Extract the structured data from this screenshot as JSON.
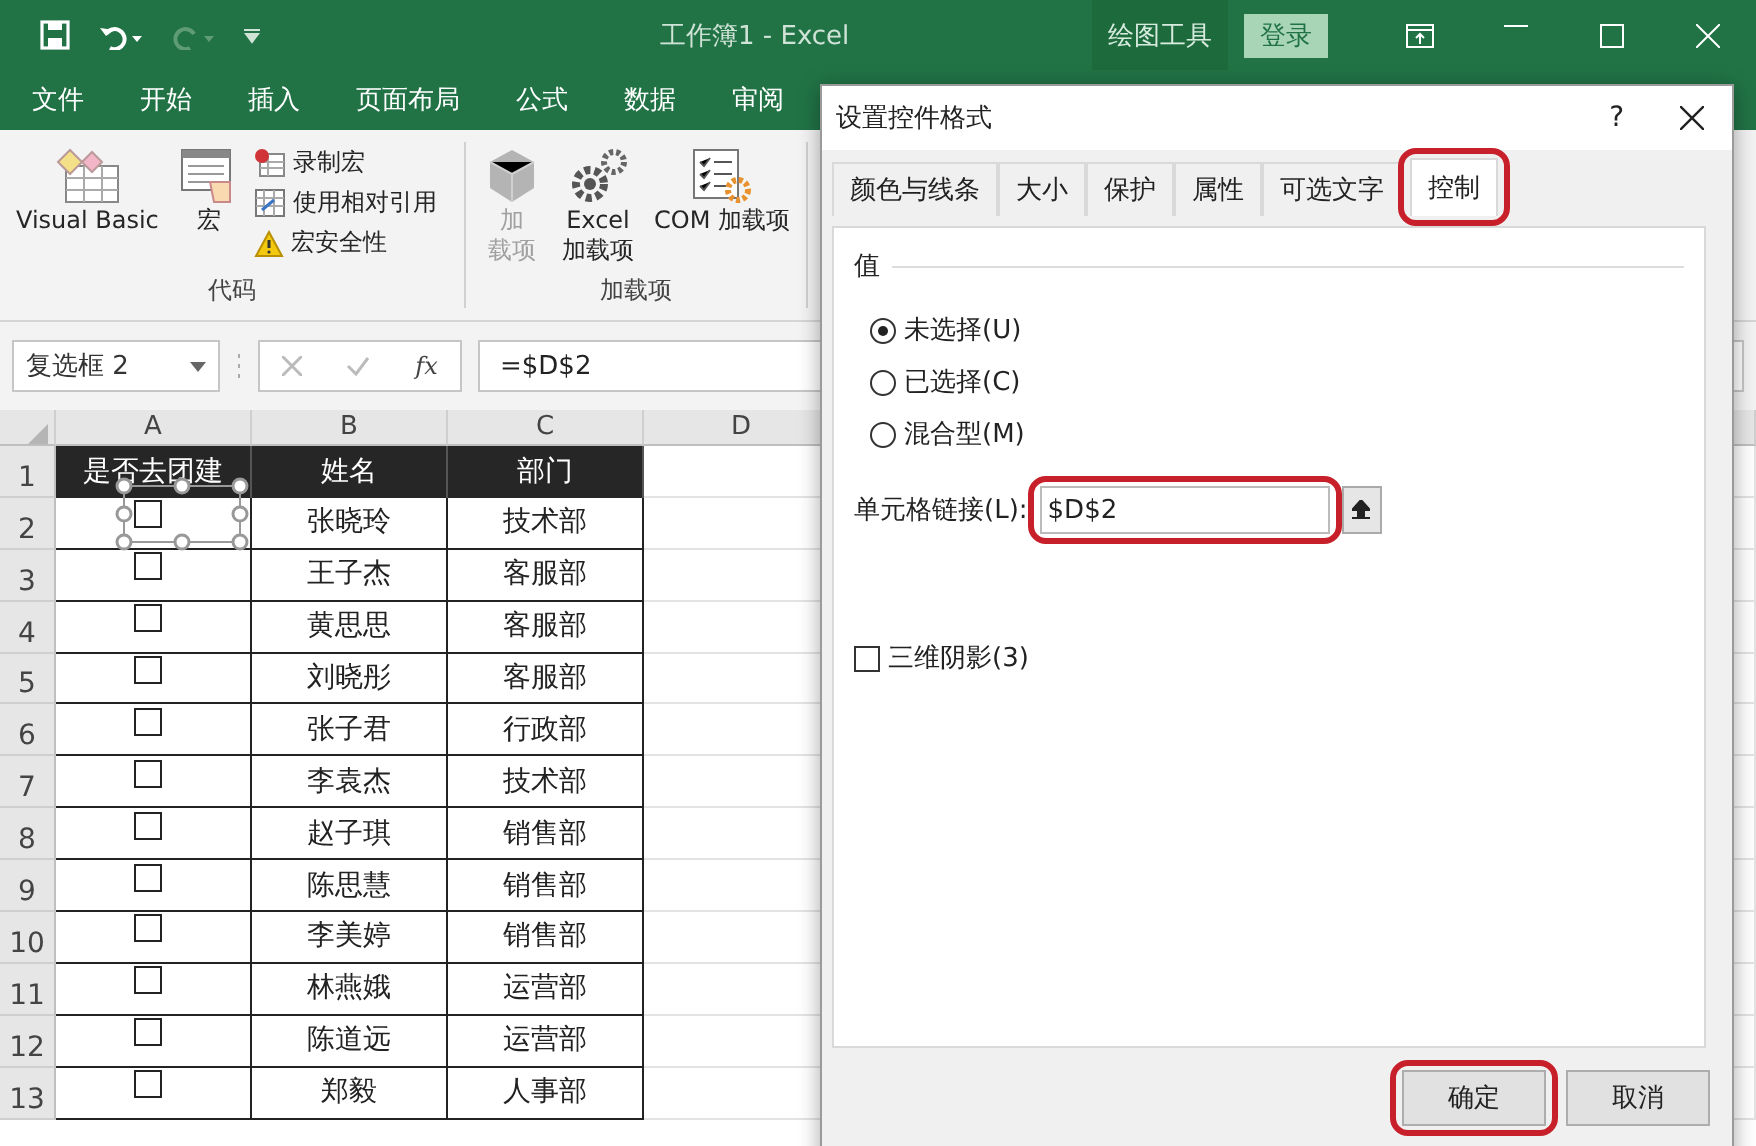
{
  "window": {
    "title": "工作簿1  -  Excel",
    "context_tab": "绘图工具",
    "sign_in": "登录"
  },
  "menu": [
    "文件",
    "开始",
    "插入",
    "页面布局",
    "公式",
    "数据",
    "审阅"
  ],
  "ribbon": {
    "groups": [
      {
        "label": "代码",
        "large": [
          {
            "kind": "vba",
            "lines": [
              "Visual Basic"
            ],
            "disabled": false
          },
          {
            "kind": "macro",
            "lines": [
              "宏"
            ],
            "disabled": false
          }
        ],
        "small": [
          {
            "kind": "record",
            "label": "录制宏"
          },
          {
            "kind": "relative",
            "label": "使用相对引用"
          },
          {
            "kind": "security",
            "label": "宏安全性"
          }
        ]
      },
      {
        "label": "加载项",
        "large": [
          {
            "kind": "addins",
            "lines": [
              "加",
              "载项"
            ],
            "disabled": true
          },
          {
            "kind": "gears",
            "lines": [
              "Excel",
              "加载项"
            ],
            "disabled": false
          },
          {
            "kind": "com",
            "lines": [
              "COM 加载项"
            ],
            "disabled": false
          }
        ]
      }
    ]
  },
  "formula_bar": {
    "name_box": "复选框 2",
    "function_label": "fx",
    "formula": "=$D$2"
  },
  "sheet": {
    "columns": [
      "A",
      "B",
      "C",
      "D"
    ],
    "header_row": {
      "number": "1",
      "cells": [
        "是否去团建",
        "姓名",
        "部门"
      ]
    },
    "rows": [
      {
        "number": "2",
        "checked": false,
        "selected": true,
        "name": "张晓玲",
        "dept": "技术部"
      },
      {
        "number": "3",
        "checked": false,
        "selected": false,
        "name": "王子杰",
        "dept": "客服部"
      },
      {
        "number": "4",
        "checked": false,
        "selected": false,
        "name": "黄思思",
        "dept": "客服部"
      },
      {
        "number": "5",
        "checked": false,
        "selected": false,
        "name": "刘晓彤",
        "dept": "客服部"
      },
      {
        "number": "6",
        "checked": false,
        "selected": false,
        "name": "张子君",
        "dept": "行政部"
      },
      {
        "number": "7",
        "checked": false,
        "selected": false,
        "name": "李袁杰",
        "dept": "技术部"
      },
      {
        "number": "8",
        "checked": false,
        "selected": false,
        "name": "赵子琪",
        "dept": "销售部"
      },
      {
        "number": "9",
        "checked": false,
        "selected": false,
        "name": "陈思慧",
        "dept": "销售部"
      },
      {
        "number": "10",
        "checked": false,
        "selected": false,
        "name": "李美婷",
        "dept": "销售部"
      },
      {
        "number": "11",
        "checked": false,
        "selected": false,
        "name": "林燕娥",
        "dept": "运营部"
      },
      {
        "number": "12",
        "checked": false,
        "selected": false,
        "name": "陈道远",
        "dept": "运营部"
      },
      {
        "number": "13",
        "checked": false,
        "selected": false,
        "name": "郑毅",
        "dept": "人事部"
      }
    ]
  },
  "dialog": {
    "title": "设置控件格式",
    "help": "?",
    "tabs": [
      {
        "label": "颜色与线条",
        "selected": false,
        "highlighted": false
      },
      {
        "label": "大小",
        "selected": false,
        "highlighted": false
      },
      {
        "label": "保护",
        "selected": false,
        "highlighted": false
      },
      {
        "label": "属性",
        "selected": false,
        "highlighted": false
      },
      {
        "label": "可选文字",
        "selected": false,
        "highlighted": false
      },
      {
        "label": "控制",
        "selected": true,
        "highlighted": true
      }
    ],
    "section": "值",
    "radios": [
      {
        "label": "未选择(U)",
        "selected": true
      },
      {
        "label": "已选择(C)",
        "selected": false
      },
      {
        "label": "混合型(M)",
        "selected": false
      }
    ],
    "cell_link": {
      "label": "单元格链接(L):",
      "value": "$D$2",
      "highlighted": true
    },
    "shading": {
      "label": "三维阴影(3)",
      "checked": false
    },
    "buttons": [
      {
        "label": "确定",
        "highlighted": true
      },
      {
        "label": "取消",
        "highlighted": false
      }
    ]
  }
}
